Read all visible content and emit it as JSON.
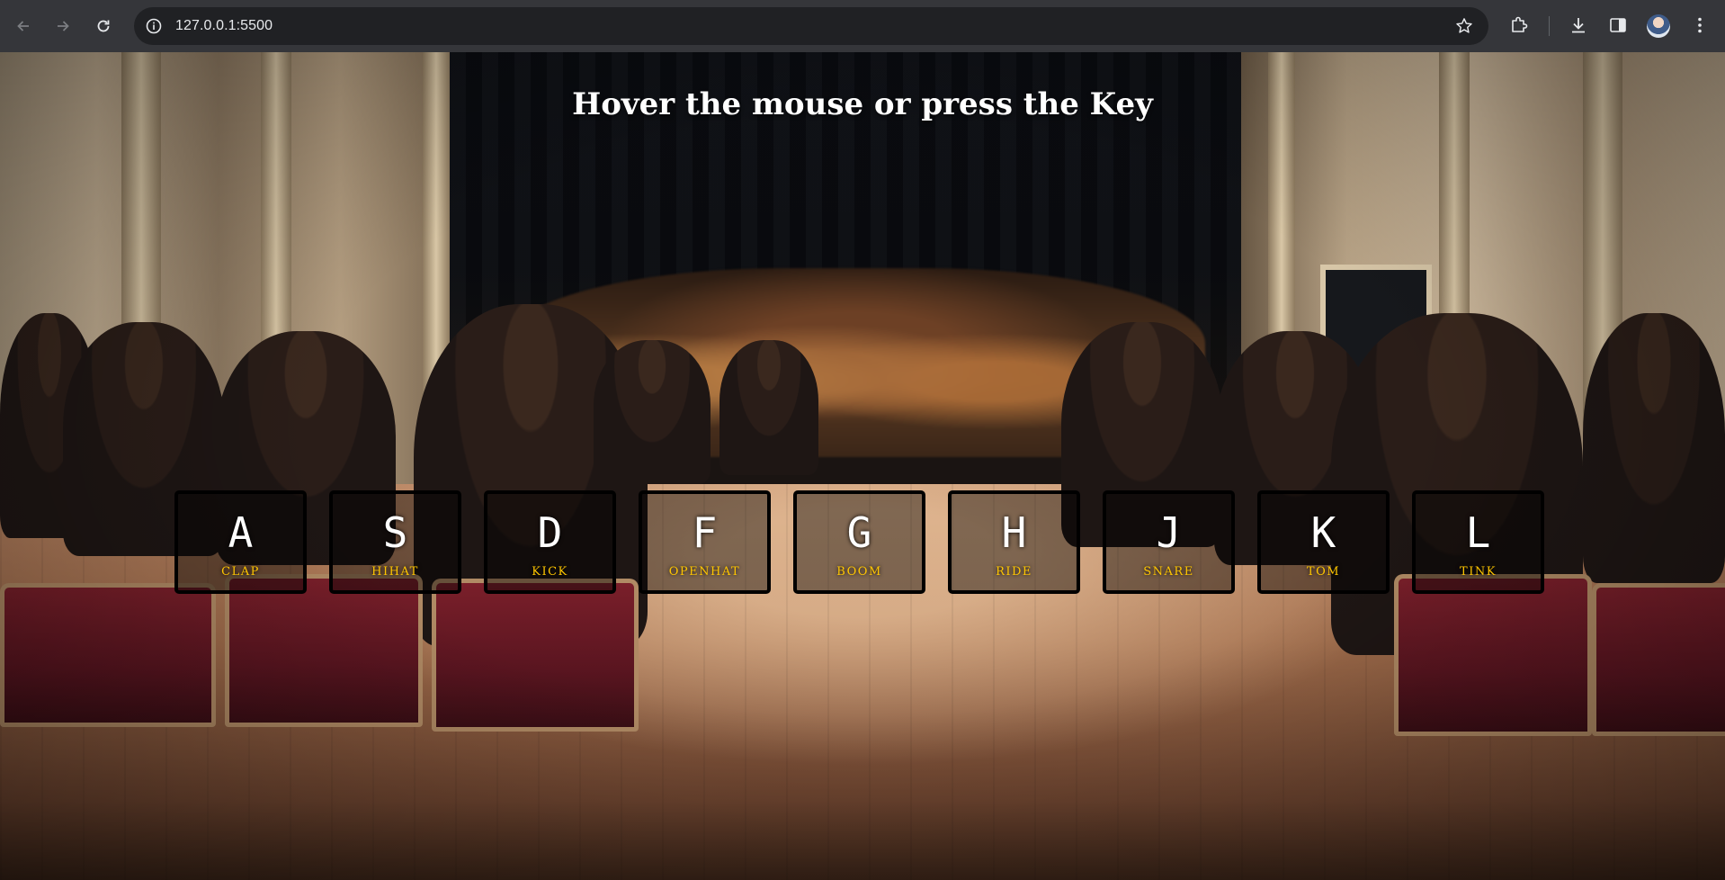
{
  "browser": {
    "url": "127.0.0.1:5500",
    "icons": {
      "back": "arrow-left-icon",
      "forward": "arrow-right-icon",
      "reload": "reload-icon",
      "site_info": "info-icon",
      "bookmark": "star-icon",
      "extensions": "puzzle-icon",
      "downloads": "download-icon",
      "side_panel": "side-panel-icon",
      "menu": "more-vert-icon"
    }
  },
  "page": {
    "title": "Hover the mouse or press the Key",
    "accent_color": "#ffc600",
    "keys": [
      {
        "letter": "A",
        "sound": "CLAP"
      },
      {
        "letter": "S",
        "sound": "HIHAT"
      },
      {
        "letter": "D",
        "sound": "KICK"
      },
      {
        "letter": "F",
        "sound": "OPENHAT"
      },
      {
        "letter": "G",
        "sound": "BOOM"
      },
      {
        "letter": "H",
        "sound": "RIDE"
      },
      {
        "letter": "J",
        "sound": "SNARE"
      },
      {
        "letter": "K",
        "sound": "TOM"
      },
      {
        "letter": "L",
        "sound": "TINK"
      }
    ]
  }
}
